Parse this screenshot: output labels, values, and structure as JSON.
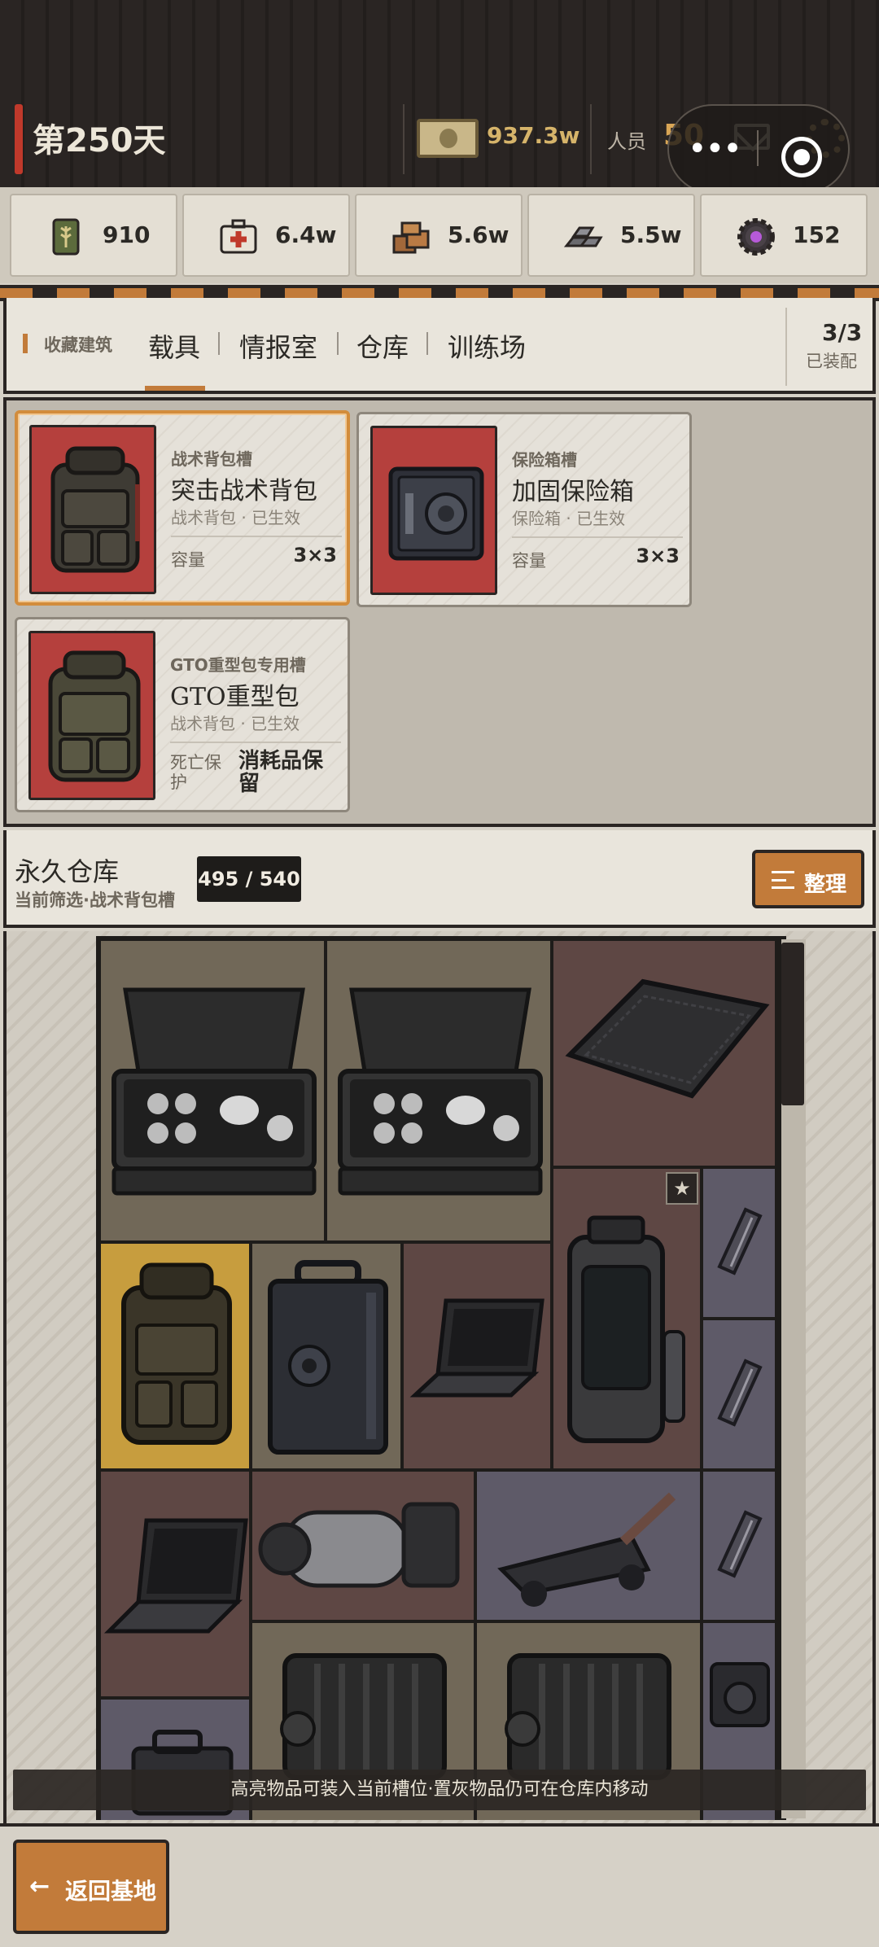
{
  "header": {
    "day": "第250天",
    "money": "937.3w",
    "staff_label": "人员",
    "staff_value": "50"
  },
  "resources": [
    {
      "icon": "wheat-ration-can-icon",
      "value": "910"
    },
    {
      "icon": "medkit-icon",
      "value": "6.4w"
    },
    {
      "icon": "wood-planks-icon",
      "value": "5.6w"
    },
    {
      "icon": "steel-ingots-icon",
      "value": "5.5w"
    },
    {
      "icon": "purple-gear-core-icon",
      "value": "152"
    }
  ],
  "tabs": {
    "category": "收藏建筑",
    "items": [
      "载具",
      "情报室",
      "仓库",
      "训练场"
    ],
    "active_index": 0,
    "equip_count": "3/3",
    "equip_label": "已装配"
  },
  "slots": [
    {
      "slot_type": "战术背包槽",
      "name": "突击战术背包",
      "status": "战术背包 · 已生效",
      "key": "容量",
      "value": "3×3",
      "selected": true,
      "icon": "tactical-backpack-icon"
    },
    {
      "slot_type": "保险箱槽",
      "name": "加固保险箱",
      "status": "保险箱 · 已生效",
      "key": "容量",
      "value": "3×3",
      "selected": false,
      "icon": "safe-box-icon"
    },
    {
      "slot_type": "GTO重型包专用槽",
      "name": "GTO重型包",
      "status": "战术背包 · 已生效",
      "key": "死亡保护",
      "value": "消耗品保留",
      "selected": false,
      "icon": "heavy-backpack-icon"
    }
  ],
  "warehouse": {
    "title": "永久仓库",
    "filter": "当前筛选·战术背包槽",
    "count": "495 / 540",
    "sort_label": "整理"
  },
  "items": [
    {
      "name": "tea-set-case-icon",
      "bg": "olive"
    },
    {
      "name": "tea-set-case-icon",
      "bg": "olive"
    },
    {
      "name": "carbon-plate-icon",
      "bg": "maroon"
    },
    {
      "name": "tactical-backpack-icon",
      "bg": "gold"
    },
    {
      "name": "safe-box-icon",
      "bg": "olive"
    },
    {
      "name": "laptop-icon",
      "bg": "maroon"
    },
    {
      "name": "cryo-canister-icon",
      "bg": "maroon",
      "starred": true
    },
    {
      "name": "clip-icon",
      "bg": "slate"
    },
    {
      "name": "clip-icon",
      "bg": "slate"
    },
    {
      "name": "laptop-icon",
      "bg": "maroon"
    },
    {
      "name": "motor-core-icon",
      "bg": "maroon"
    },
    {
      "name": "floor-jack-icon",
      "bg": "slate"
    },
    {
      "name": "clip-icon",
      "bg": "slate"
    },
    {
      "name": "generator-crate-icon",
      "bg": "olive"
    },
    {
      "name": "generator-crate-icon",
      "bg": "olive"
    },
    {
      "name": "camera-icon",
      "bg": "slate"
    },
    {
      "name": "crate-icon",
      "bg": "slate"
    }
  ],
  "star_glyph": "★",
  "hint": "高亮物品可装入当前槽位·置灰物品仍可在仓库内移动",
  "back": {
    "arrow": "←",
    "label": "返回基地"
  },
  "colors": {
    "accent": "#c27b3a",
    "red_card": "#b5403d",
    "gold_money": "#d6b46a"
  }
}
